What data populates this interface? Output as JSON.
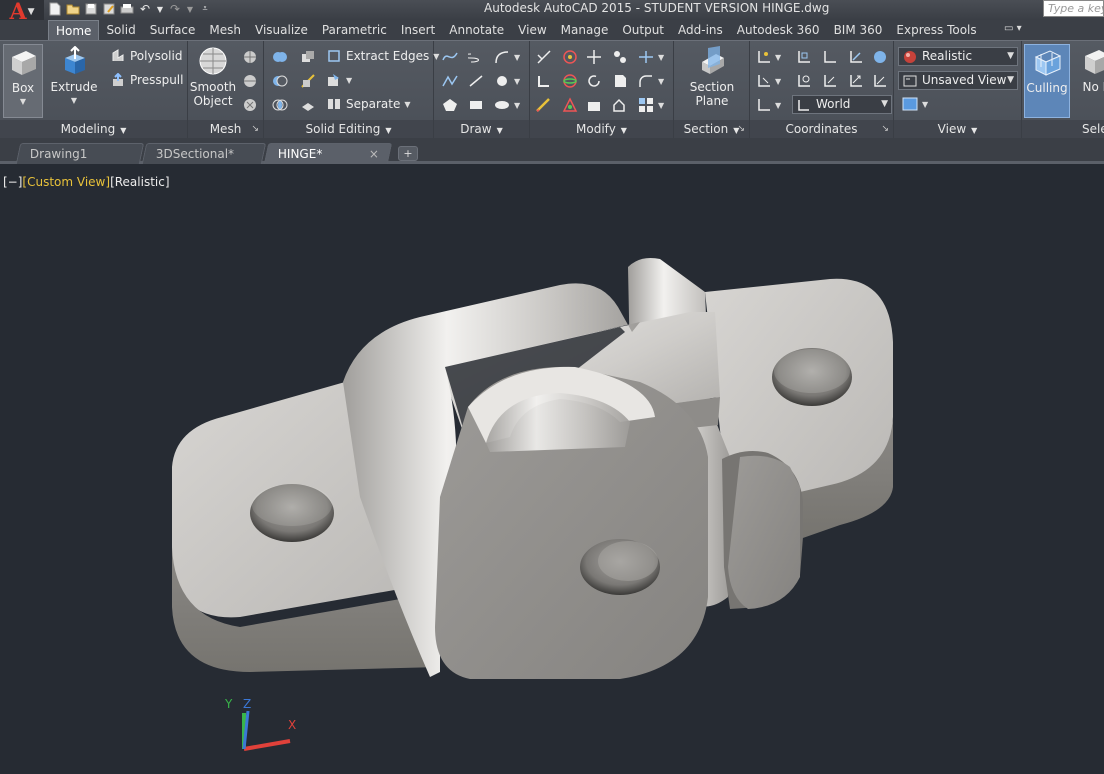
{
  "title_bar": {
    "title": "Autodesk AutoCAD 2015 - STUDENT VERSION    HINGE.dwg",
    "search_placeholder": "Type a keyword or phrase"
  },
  "ribbon_tabs": [
    "Home",
    "Solid",
    "Surface",
    "Mesh",
    "Visualize",
    "Parametric",
    "Insert",
    "Annotate",
    "View",
    "Manage",
    "Output",
    "Add-ins",
    "Autodesk 360",
    "BIM 360",
    "Express Tools"
  ],
  "active_tab": "Home",
  "panels": {
    "modeling": {
      "title": "Modeling",
      "box": "Box",
      "extrude": "Extrude",
      "polysolid": "Polysolid",
      "presspull": "Presspull"
    },
    "mesh": {
      "title": "Mesh",
      "smooth_object_line1": "Smooth",
      "smooth_object_line2": "Object"
    },
    "solid_editing": {
      "title": "Solid Editing",
      "extract_edges": "Extract Edges",
      "separate": "Separate"
    },
    "draw": {
      "title": "Draw"
    },
    "modify": {
      "title": "Modify"
    },
    "section": {
      "title": "Section",
      "section_plane_line1": "Section",
      "section_plane_line2": "Plane"
    },
    "coordinates": {
      "title": "Coordinates",
      "ucs_value": "World"
    },
    "view": {
      "title": "View",
      "visual_style": "Realistic",
      "named_view": "Unsaved View"
    },
    "selection": {
      "title": "Sele",
      "culling": "Culling",
      "no_filter": "No F"
    }
  },
  "document_tabs": [
    {
      "label": "Drawing1",
      "active": false
    },
    {
      "label": "3DSectional*",
      "active": false
    },
    {
      "label": "HINGE*",
      "active": true,
      "close": "×"
    }
  ],
  "new_tab": "+",
  "viewport_controls": {
    "minus": "[−]",
    "view": "[Custom View]",
    "style": "[Realistic]"
  },
  "ucs": {
    "x": "X",
    "y": "Y",
    "z": "Z"
  },
  "colors": {
    "background": "#262b33",
    "ribbon": "#4f545c",
    "accent_yellow": "#e8c23a",
    "autocad_red": "#e03a2e"
  }
}
